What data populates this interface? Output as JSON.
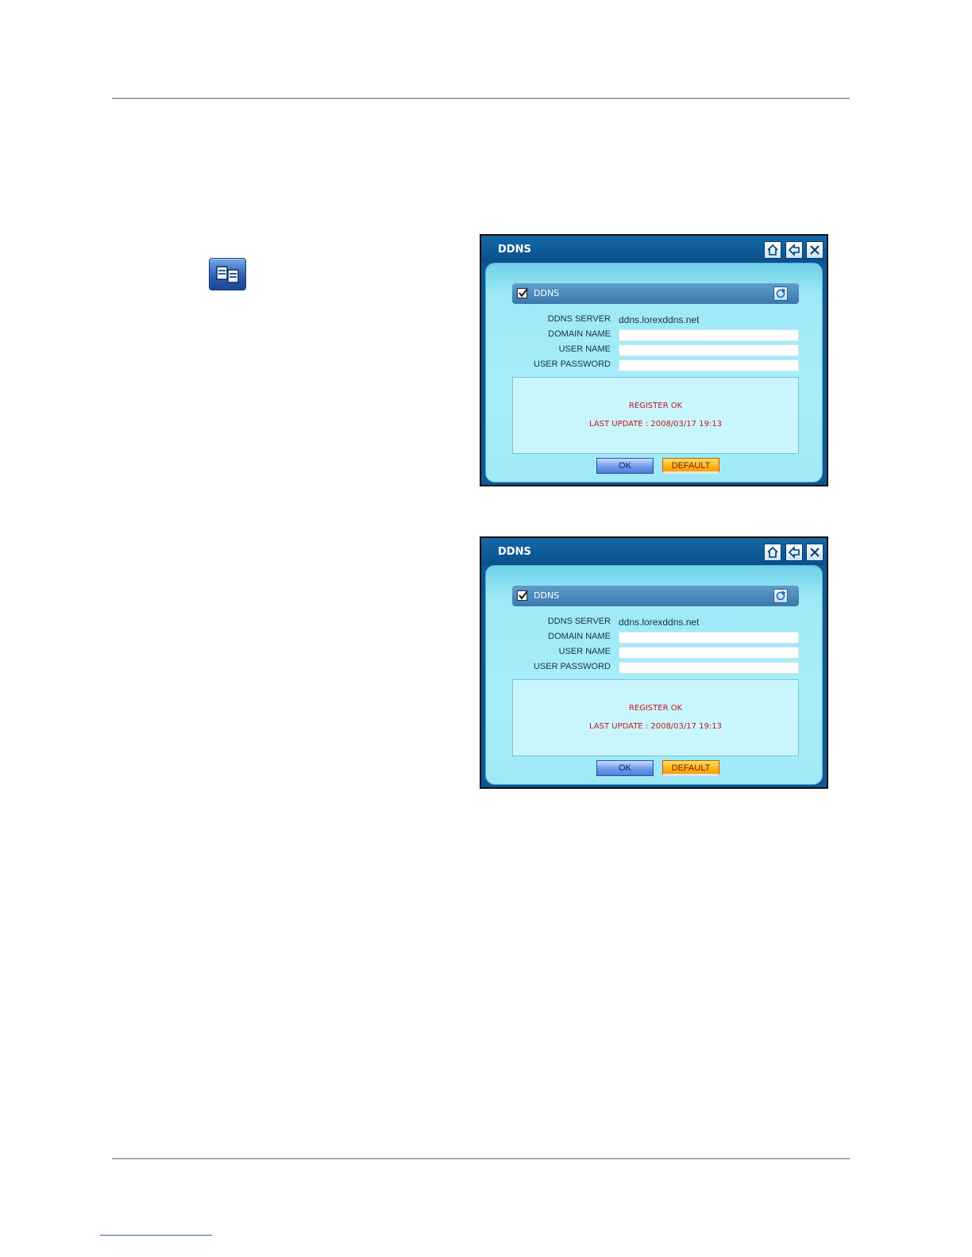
{
  "toolbar_icon": {
    "name": "network-settings-icon"
  },
  "dialogs": [
    {
      "title": "DDNS",
      "section": {
        "label": "DDNS",
        "checked": true
      },
      "fields": {
        "server_label": "DDNS SERVER",
        "server_value": "ddns.lorexddns.net",
        "domain_label": "DOMAIN NAME",
        "domain_value": "",
        "user_label": "USER NAME",
        "user_value": "",
        "password_label": "USER PASSWORD",
        "password_value": ""
      },
      "status": {
        "line1": "REGISTER OK",
        "line2": "LAST UPDATE : 2008/03/17 19:13"
      },
      "buttons": {
        "ok": "OK",
        "default": "DEFAULT"
      }
    },
    {
      "title": "DDNS",
      "section": {
        "label": "DDNS",
        "checked": true
      },
      "fields": {
        "server_label": "DDNS SERVER",
        "server_value": "ddns.lorexddns.net",
        "domain_label": "DOMAIN NAME",
        "domain_value": "",
        "user_label": "USER NAME",
        "user_value": "",
        "password_label": "USER PASSWORD",
        "password_value": ""
      },
      "status": {
        "line1": "REGISTER OK",
        "line2": "LAST UPDATE : 2008/03/17 19:13"
      },
      "buttons": {
        "ok": "OK",
        "default": "DEFAULT"
      }
    }
  ],
  "colors": {
    "title_bar": "#0d5793",
    "panel": "#a7eefa",
    "status_text": "#c4161c",
    "ok_button": "#6f98ea",
    "default_button": "#ffb31a"
  }
}
